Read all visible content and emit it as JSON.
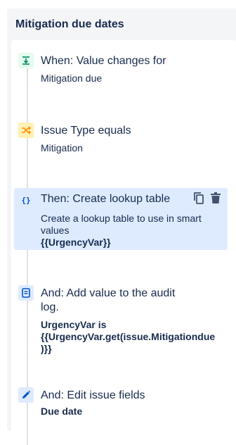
{
  "panel": {
    "title": "Mitigation due dates"
  },
  "steps": [
    {
      "icon": "trigger-icon",
      "title": "When: Value changes for",
      "desc": "Mitigation due"
    },
    {
      "icon": "shuffle-condition-icon",
      "title": "Issue Type equals",
      "desc": "Mitigation"
    },
    {
      "icon": "curly-braces-icon",
      "title": "Then: Create lookup table",
      "desc": "Create a lookup table to use in smart values",
      "desc_bold": "{{UrgencyVar}}",
      "selected": true
    },
    {
      "icon": "document-icon",
      "title_line1": "And: Add value to the audit",
      "title_line2": "log.",
      "desc_bold_line1": "UrgencyVar is",
      "desc_bold_line2": "{{UrgencyVar.get(issue.Mitigationdue",
      "desc_bold_line3": ")}}"
    },
    {
      "icon": "pencil-icon",
      "title": "And: Edit issue fields",
      "desc_bold": "Due date"
    }
  ],
  "tools": {
    "copy": "copy-icon",
    "delete": "trash-icon"
  },
  "colors": {
    "selected_bg": "#deebff",
    "trigger_bg": "#e3fcef",
    "condition_bg": "#fff0b3",
    "action_blue": "#0052cc"
  }
}
